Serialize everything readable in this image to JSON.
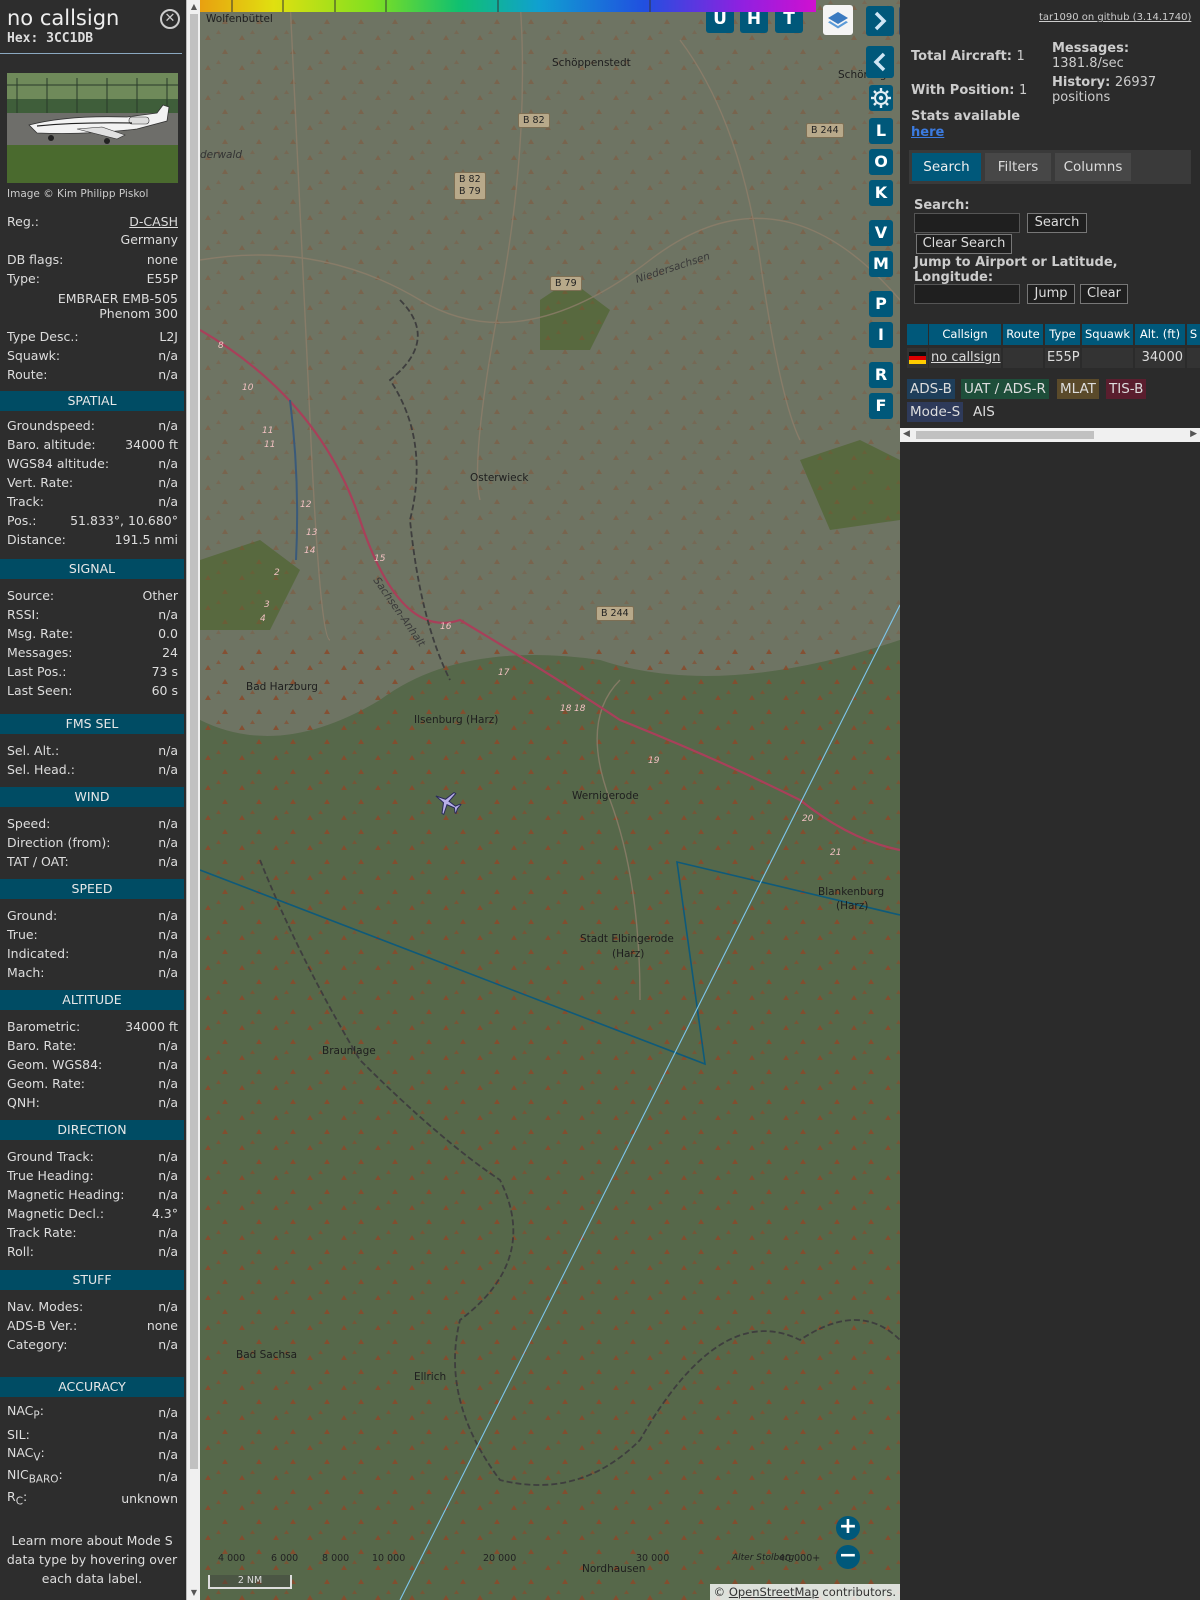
{
  "info": {
    "title": "no callsign",
    "hex": "Hex: 3CC1DB",
    "image_credit": "Image © Kim Philipp Piskol",
    "reg_label": "Reg.:",
    "reg_value": "D-CASH",
    "country": "Germany",
    "db_flags_label": "DB flags:",
    "db_flags_value": "none",
    "type_label": "Type:",
    "type_value": "E55P",
    "type_full_1": "EMBRAER EMB-505",
    "type_full_2": "Phenom 300",
    "type_desc_label": "Type Desc.:",
    "type_desc_value": "L2J",
    "squawk_label": "Squawk:",
    "squawk_value": "n/a",
    "route_label": "Route:",
    "route_value": "n/a",
    "sections": {
      "spatial": "SPATIAL",
      "signal": "SIGNAL",
      "fms": "FMS SEL",
      "wind": "WIND",
      "speed": "SPEED",
      "altitude": "ALTITUDE",
      "direction": "DIRECTION",
      "stuff": "STUFF",
      "accuracy": "ACCURACY"
    },
    "spatial": [
      {
        "k": "Groundspeed:",
        "v": "n/a"
      },
      {
        "k": "Baro. altitude:",
        "v": "34000 ft"
      },
      {
        "k": "WGS84 altitude:",
        "v": "n/a"
      },
      {
        "k": "Vert. Rate:",
        "v": "n/a"
      },
      {
        "k": "Track:",
        "v": "n/a"
      },
      {
        "k": "Pos.:",
        "v": "51.833°, 10.680°"
      },
      {
        "k": "Distance:",
        "v": "191.5 nmi"
      }
    ],
    "signal": [
      {
        "k": "Source:",
        "v": "Other"
      },
      {
        "k": "RSSI:",
        "v": "n/a"
      },
      {
        "k": "Msg. Rate:",
        "v": "0.0"
      },
      {
        "k": "Messages:",
        "v": "24"
      },
      {
        "k": "Last Pos.:",
        "v": "73 s"
      },
      {
        "k": "Last Seen:",
        "v": "60 s"
      }
    ],
    "fms": [
      {
        "k": "Sel. Alt.:",
        "v": "n/a"
      },
      {
        "k": "Sel. Head.:",
        "v": "n/a"
      }
    ],
    "wind": [
      {
        "k": "Speed:",
        "v": "n/a"
      },
      {
        "k": "Direction (from):",
        "v": "n/a"
      },
      {
        "k": "TAT / OAT:",
        "v": "n/a"
      }
    ],
    "speed": [
      {
        "k": "Ground:",
        "v": "n/a"
      },
      {
        "k": "True:",
        "v": "n/a"
      },
      {
        "k": "Indicated:",
        "v": "n/a"
      },
      {
        "k": "Mach:",
        "v": "n/a"
      }
    ],
    "altitude": [
      {
        "k": "Barometric:",
        "v": "34000 ft"
      },
      {
        "k": "Baro. Rate:",
        "v": "n/a"
      },
      {
        "k": "Geom. WGS84:",
        "v": "n/a"
      },
      {
        "k": "Geom. Rate:",
        "v": "n/a"
      },
      {
        "k": "QNH:",
        "v": "n/a"
      }
    ],
    "direction": [
      {
        "k": "Ground Track:",
        "v": "n/a"
      },
      {
        "k": "True Heading:",
        "v": "n/a"
      },
      {
        "k": "Magnetic Heading:",
        "v": "n/a"
      },
      {
        "k": "Magnetic Decl.:",
        "v": "4.3°"
      },
      {
        "k": "Track Rate:",
        "v": "n/a"
      },
      {
        "k": "Roll:",
        "v": "n/a"
      }
    ],
    "stuff": [
      {
        "k": "Nav. Modes:",
        "v": "n/a"
      },
      {
        "k": "ADS-B Ver.:",
        "v": "none"
      },
      {
        "k": "Category:",
        "v": "n/a"
      }
    ],
    "accuracy": {
      "nacp_k": "NAC",
      "nacp_sub": "P",
      "nacp_v": "n/a",
      "sil_k": "SIL:",
      "sil_v": "n/a",
      "nacv_k": "NAC",
      "nacv_sub": "V",
      "nacv_v": "n/a",
      "nicbaro_k": "NIC",
      "nicbaro_sub": "BARO",
      "nicbaro_v": "n/a",
      "rc_k": "R",
      "rc_sub": "C",
      "rc_v": "unknown"
    },
    "note": "Learn more about Mode S data type by hovering over each data label."
  },
  "map": {
    "top_buttons": [
      "U",
      "H",
      "T"
    ],
    "side_buttons": [
      "L",
      "O",
      "K",
      "V",
      "M",
      "P",
      "I",
      "R",
      "F"
    ],
    "towns": [
      "Wolfenbüttel",
      "Schöppenstedt",
      "Schöninge",
      "Osterwieck",
      "Bad Harzburg",
      "Ilsenburg (Harz)",
      "Wernigerode",
      "Blankenburg",
      "(Harz)",
      "Stadt Elbingerode",
      "(Harz)",
      "Braunlage",
      "Bad Sachsa",
      "Ellrich",
      "Nordhausen",
      "Alter Stolberg",
      "Niedersachsen",
      "Sachsen-Anhalt",
      "derwald"
    ],
    "roads": [
      "B 82",
      "B 82",
      "B 79",
      "B 79",
      "B 244",
      "B 244"
    ],
    "highway_numbers": [
      "8",
      "10",
      "11",
      "11",
      "12",
      "13",
      "14",
      "15",
      "16",
      "17",
      "18",
      "18",
      "19",
      "20",
      "21",
      "2",
      "3",
      "4"
    ],
    "altitude_scale": [
      "4 000",
      "6 000",
      "8 000",
      "10 000",
      "20 000",
      "30 000",
      "40 000+"
    ],
    "scale_bar": "2 NM",
    "attribution_prefix": "© ",
    "attribution_link": "OpenStreetMap",
    "attribution_suffix": " contributors.",
    "zoom_in": "+",
    "zoom_out": "−",
    "colors": {
      "panel_header": "#004c64",
      "button": "#00587a",
      "terrain": "#5c6951"
    }
  },
  "right": {
    "version": "tar1090 on github (3.14.1740)",
    "total_aircraft_label": "Total Aircraft:",
    "total_aircraft_value": "1",
    "with_position_label": "With Position:",
    "with_position_value": "1",
    "messages_label": "Messages:",
    "messages_value": "1381.8/sec",
    "history_label": "History:",
    "history_value": "26937",
    "history_unit": "positions",
    "stats_label": "Stats available",
    "stats_link": "here",
    "tabs": [
      "Search",
      "Filters",
      "Columns"
    ],
    "search_label": "Search:",
    "search_button": "Search",
    "clear_search_button": "Clear Search",
    "jump_label": "Jump to Airport or Latitude, Longitude:",
    "jump_button": "Jump",
    "clear_button": "Clear",
    "columns": [
      "Callsign",
      "Route",
      "Type",
      "Squawk",
      "Alt. (ft)",
      "S"
    ],
    "row": {
      "callsign": "no callsign",
      "route": "",
      "type": "E55P",
      "squawk": "",
      "alt": "34000"
    },
    "legend": [
      "ADS-B",
      "UAT / ADS-R",
      "MLAT",
      "TIS-B",
      "Mode-S",
      "AIS"
    ],
    "legend_colors": {
      "adsb": "#1e3e5a",
      "uat": "#1e4e3a",
      "mlat": "#5a4a2a",
      "tisb": "#5a1e2e",
      "modes": "#2e3a5a"
    }
  }
}
